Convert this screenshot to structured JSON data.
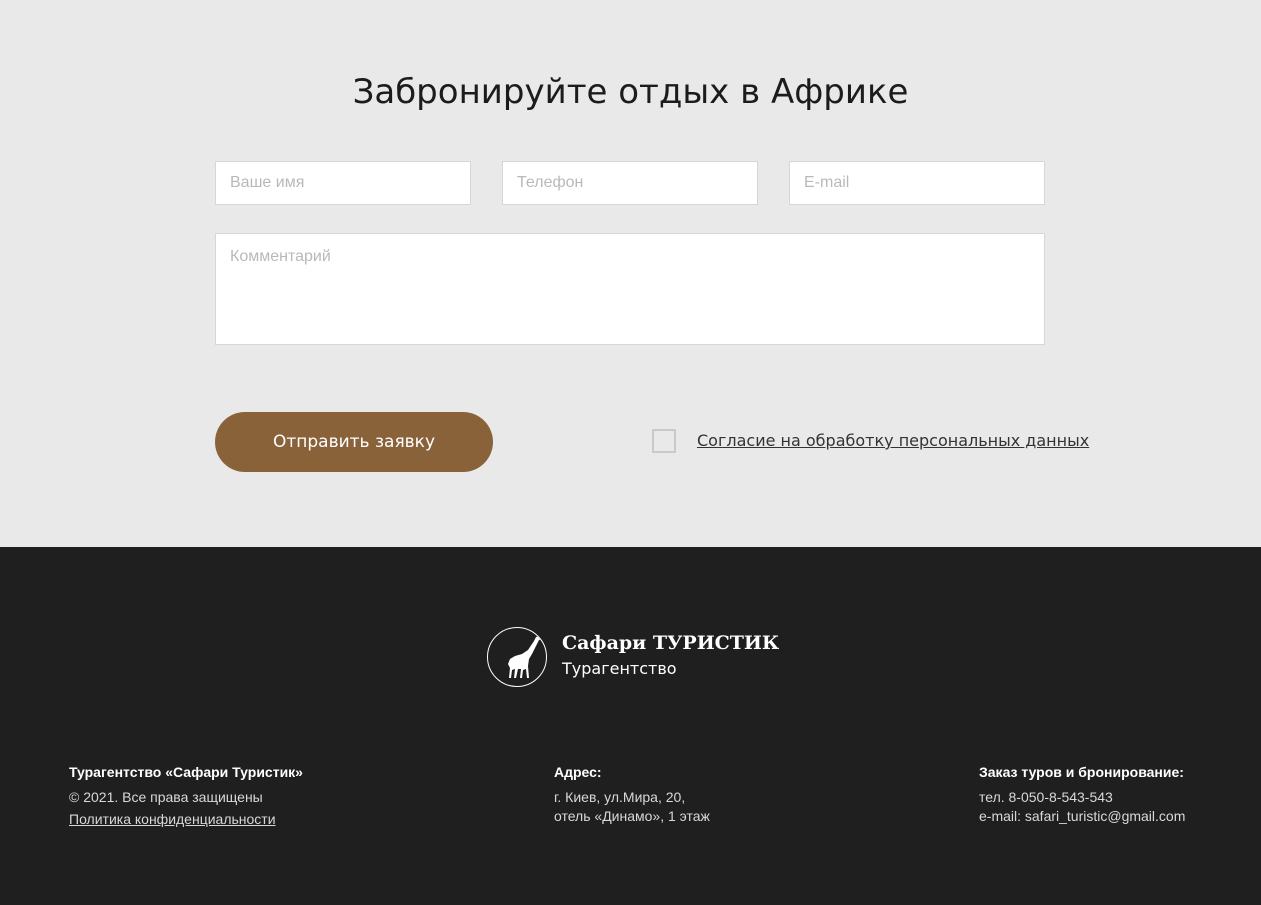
{
  "booking": {
    "title": "Забронируйте отдых в Африке",
    "name_placeholder": "Ваше имя",
    "phone_placeholder": "Телефон",
    "email_placeholder": "E-mail",
    "comment_placeholder": "Комментарий",
    "submit_label": "Отправить заявку",
    "consent_label": "Согласие на обработку персональных данных",
    "consent_checked": false,
    "colors": {
      "background": "#e9e9e9",
      "accent": "#8a623a"
    }
  },
  "footer": {
    "logo": {
      "icon": "giraffe-icon",
      "title": "Сафари ТУРИСТИК",
      "subtitle": "Турагентство"
    },
    "col1": {
      "heading": "Турагентство «Сафари Туристик»",
      "copyright": "© 2021. Все права защищены",
      "privacy_link": "Политика конфиденциальности"
    },
    "col2": {
      "heading": "Адрес:",
      "line1": "г. Киев, ул.Мира, 20,",
      "line2": "отель «Динамо», 1 этаж"
    },
    "col3": {
      "heading": "Заказ туров и бронирование:",
      "phone": "тел. 8-050-8-543-543",
      "email": "e-mail: safari_turistic@gmail.com"
    },
    "colors": {
      "background": "#1f1f1f"
    }
  }
}
